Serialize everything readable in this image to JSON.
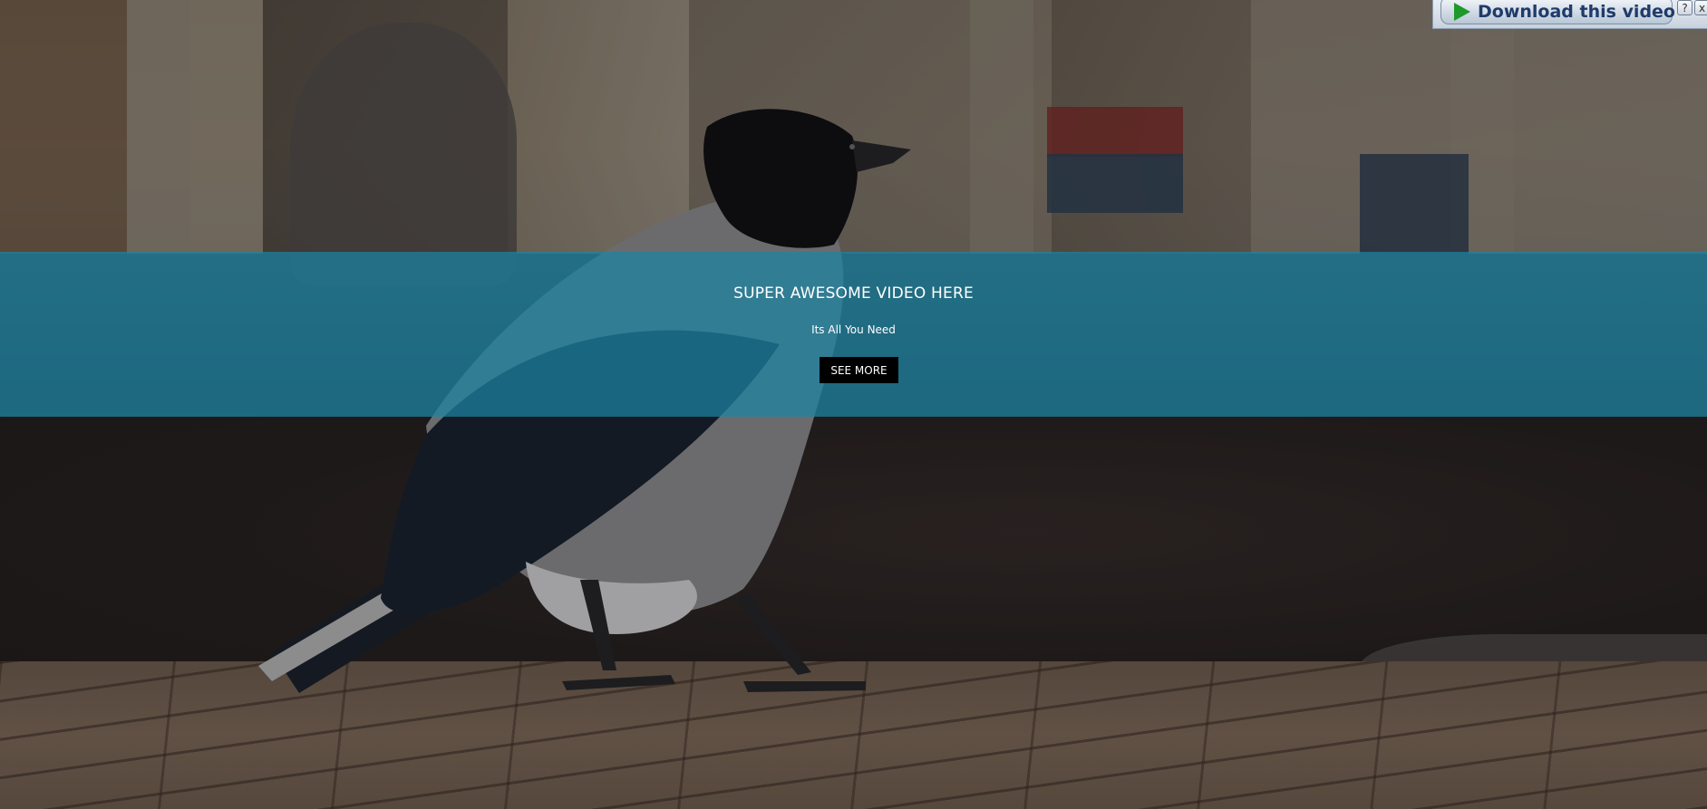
{
  "hero": {
    "title": "SUPER AWESOME VIDEO HERE",
    "subtitle": "Its All You Need",
    "cta_label": "SEE MORE",
    "band_color": "#1b84a3",
    "cta_color": "#000000"
  },
  "download_bar": {
    "label": "Download this video",
    "play_icon": "play-icon",
    "help_label": "?",
    "close_label": "x",
    "accent": "#1f9a2a"
  },
  "background": {
    "icon": "crow-video-frame"
  }
}
